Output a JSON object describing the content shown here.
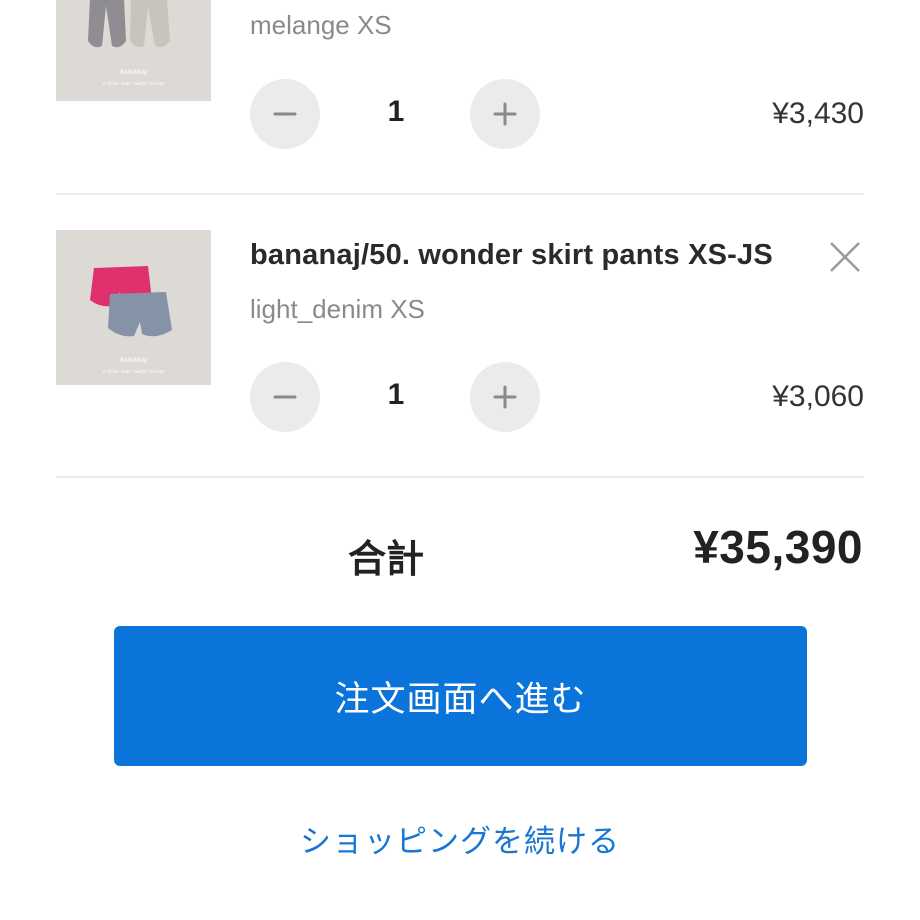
{
  "cart": {
    "items": [
      {
        "name": "",
        "variant": "melange XS",
        "quantity": "1",
        "price": "¥3,430",
        "image_icon": "pants-photo"
      },
      {
        "name": "bananaj/50. wonder skirt pants XS-JS",
        "variant": "light_denim XS",
        "quantity": "1",
        "price": "¥3,060",
        "image_icon": "skirt-pants-photo"
      }
    ]
  },
  "summary": {
    "total_label": "合計",
    "total_value": "¥35,390"
  },
  "actions": {
    "checkout_label": "注文画面へ進む",
    "continue_label": "ショッピングを続ける"
  },
  "colors": {
    "accent": "#0a74da",
    "link": "#1976d2",
    "stepper_bg": "#ebebeb"
  }
}
